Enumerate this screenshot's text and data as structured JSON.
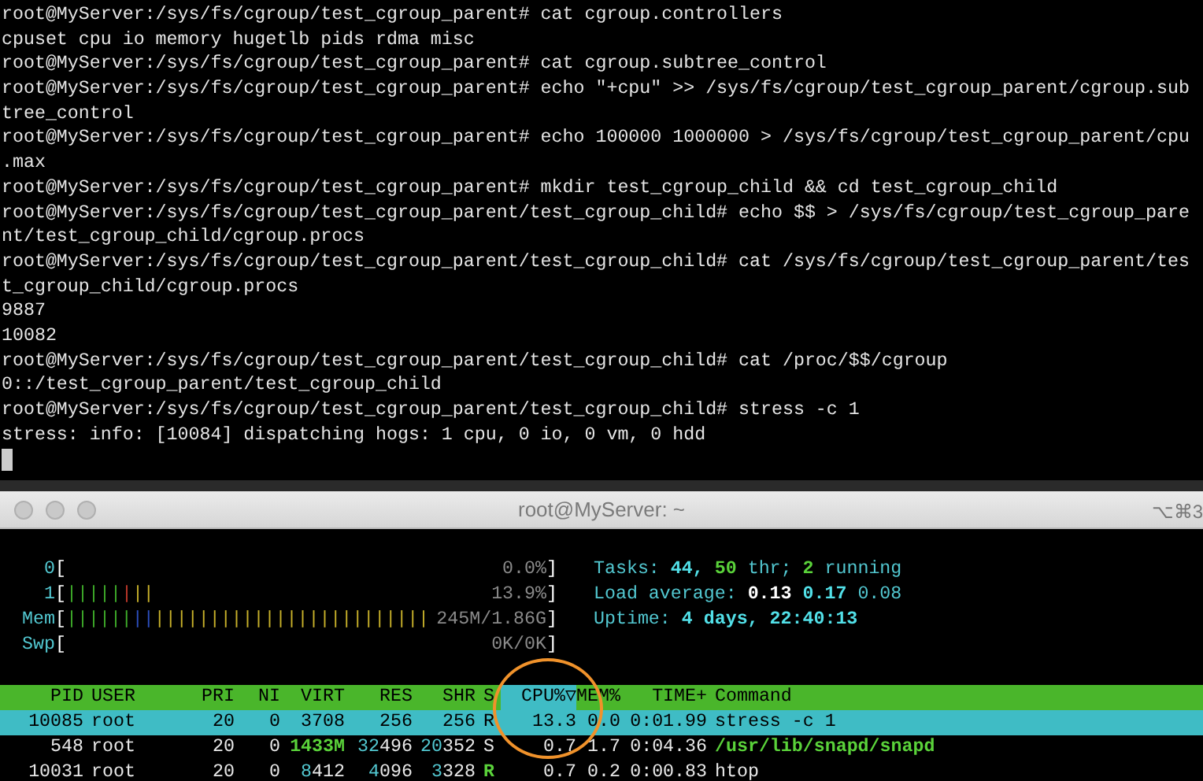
{
  "terminal": {
    "lines": [
      "root@MyServer:/sys/fs/cgroup/test_cgroup_parent# cat cgroup.controllers",
      "cpuset cpu io memory hugetlb pids rdma misc",
      "root@MyServer:/sys/fs/cgroup/test_cgroup_parent# cat cgroup.subtree_control",
      "root@MyServer:/sys/fs/cgroup/test_cgroup_parent# echo \"+cpu\" >> /sys/fs/cgroup/test_cgroup_parent/cgroup.sub",
      "tree_control",
      "root@MyServer:/sys/fs/cgroup/test_cgroup_parent# echo 100000 1000000 > /sys/fs/cgroup/test_cgroup_parent/cpu",
      ".max",
      "root@MyServer:/sys/fs/cgroup/test_cgroup_parent# mkdir test_cgroup_child && cd test_cgroup_child",
      "root@MyServer:/sys/fs/cgroup/test_cgroup_parent/test_cgroup_child# echo $$ > /sys/fs/cgroup/test_cgroup_pare",
      "nt/test_cgroup_child/cgroup.procs",
      "root@MyServer:/sys/fs/cgroup/test_cgroup_parent/test_cgroup_child# cat /sys/fs/cgroup/test_cgroup_parent/tes",
      "t_cgroup_child/cgroup.procs",
      "9887",
      "10082",
      "root@MyServer:/sys/fs/cgroup/test_cgroup_parent/test_cgroup_child# cat /proc/$$/cgroup",
      "0::/test_cgroup_parent/test_cgroup_child",
      "root@MyServer:/sys/fs/cgroup/test_cgroup_parent/test_cgroup_child# stress -c 1",
      "stress: info: [10084] dispatching hogs: 1 cpu, 0 io, 0 vm, 0 hdd"
    ]
  },
  "htop": {
    "title": "root@MyServer: ~",
    "shortcut": "⌥⌘3",
    "meters": [
      {
        "label": "0",
        "open": "[",
        "reading": "0.0%",
        "close": "]"
      },
      {
        "label": "1",
        "open": "[",
        "segments": [
          {
            "color": "#3fae2a",
            "text": "|||||"
          },
          {
            "color": "#c0392b",
            "text": "|"
          },
          {
            "color": "#c8b12a",
            "text": "||"
          }
        ],
        "reading": "13.9%",
        "close": "]"
      },
      {
        "label": "Mem",
        "open": "[",
        "segments": [
          {
            "color": "#3fae2a",
            "text": "||||||"
          },
          {
            "color": "#2c4fc0",
            "text": "||"
          },
          {
            "color": "#c8b12a",
            "text": "|||||||||||||||||||||||||"
          }
        ],
        "reading": "245M/1.86G",
        "close": "]"
      },
      {
        "label": "Swp",
        "open": "[",
        "reading": "0K/0K",
        "close": "]"
      }
    ],
    "info": [
      [
        {
          "text": "Tasks: ",
          "kind": "label"
        },
        {
          "text": "44, ",
          "kind": "bright"
        },
        {
          "text": "50 ",
          "kind": "green"
        },
        {
          "text": "thr; ",
          "kind": "label"
        },
        {
          "text": "2 ",
          "kind": "green"
        },
        {
          "text": "running",
          "kind": "label"
        }
      ],
      [
        {
          "text": "Load average: ",
          "kind": "label"
        },
        {
          "text": "0.13 ",
          "kind": "white"
        },
        {
          "text": "0.17 ",
          "kind": "bright"
        },
        {
          "text": "0.08",
          "kind": "label"
        }
      ],
      [
        {
          "text": "Uptime: ",
          "kind": "label"
        },
        {
          "text": "4 days, 22:40:13",
          "kind": "bright"
        }
      ]
    ],
    "columns": [
      {
        "label": "PID",
        "selected": false
      },
      {
        "label": "USER",
        "selected": false
      },
      {
        "label": "PRI",
        "selected": false
      },
      {
        "label": "NI",
        "selected": false
      },
      {
        "label": "VIRT",
        "selected": false
      },
      {
        "label": "RES",
        "selected": false
      },
      {
        "label": "SHR",
        "selected": false
      },
      {
        "label": "S",
        "selected": false
      },
      {
        "label": "CPU%▽",
        "selected": true
      },
      {
        "label": "MEM%",
        "selected": false
      },
      {
        "label": "TIME+",
        "selected": false
      },
      {
        "label": "Command",
        "selected": false
      }
    ],
    "rows": [
      {
        "selected": true,
        "cells": [
          [
            {
              "text": "10085",
              "kind": "plain"
            }
          ],
          [
            {
              "text": "root",
              "kind": "plain"
            }
          ],
          [
            {
              "text": "20",
              "kind": "plain"
            }
          ],
          [
            {
              "text": "0",
              "kind": "plain"
            }
          ],
          [
            {
              "text": "3708",
              "kind": "plain"
            }
          ],
          [
            {
              "text": "256",
              "kind": "plain"
            }
          ],
          [
            {
              "text": "256",
              "kind": "plain"
            }
          ],
          [
            {
              "text": "R",
              "kind": "plain"
            }
          ],
          [
            {
              "text": "13.3",
              "kind": "plain"
            }
          ],
          [
            {
              "text": "0.0",
              "kind": "plain"
            }
          ],
          [
            {
              "text": "0:01.99",
              "kind": "plain"
            }
          ],
          [
            {
              "text": "stress -c 1",
              "kind": "plain"
            }
          ]
        ]
      },
      {
        "selected": false,
        "cells": [
          [
            {
              "text": "548",
              "kind": "plain"
            }
          ],
          [
            {
              "text": "root",
              "kind": "plain"
            }
          ],
          [
            {
              "text": "20",
              "kind": "plain"
            }
          ],
          [
            {
              "text": "0",
              "kind": "plain"
            }
          ],
          [
            {
              "text": "1433M",
              "kind": "green"
            }
          ],
          [
            {
              "text": "32",
              "kind": "label"
            },
            {
              "text": "496",
              "kind": "plain"
            }
          ],
          [
            {
              "text": "20",
              "kind": "label"
            },
            {
              "text": "352",
              "kind": "plain"
            }
          ],
          [
            {
              "text": "S",
              "kind": "plain"
            }
          ],
          [
            {
              "text": "0.7",
              "kind": "plain"
            }
          ],
          [
            {
              "text": "1.7",
              "kind": "plain"
            }
          ],
          [
            {
              "text": "0:04.36",
              "kind": "plain"
            }
          ],
          [
            {
              "text": "/usr/lib/snapd/snapd",
              "kind": "green"
            }
          ]
        ]
      },
      {
        "selected": false,
        "cells": [
          [
            {
              "text": "10031",
              "kind": "plain"
            }
          ],
          [
            {
              "text": "root",
              "kind": "plain"
            }
          ],
          [
            {
              "text": "20",
              "kind": "plain"
            }
          ],
          [
            {
              "text": "0",
              "kind": "plain"
            }
          ],
          [
            {
              "text": "8",
              "kind": "label"
            },
            {
              "text": "412",
              "kind": "plain"
            }
          ],
          [
            {
              "text": "4",
              "kind": "label"
            },
            {
              "text": "096",
              "kind": "plain"
            }
          ],
          [
            {
              "text": "3",
              "kind": "label"
            },
            {
              "text": "328",
              "kind": "plain"
            }
          ],
          [
            {
              "text": "R",
              "kind": "green"
            }
          ],
          [
            {
              "text": "0.7",
              "kind": "plain"
            }
          ],
          [
            {
              "text": "0.2",
              "kind": "plain"
            }
          ],
          [
            {
              "text": "0:00.83",
              "kind": "plain"
            }
          ],
          [
            {
              "text": "htop",
              "kind": "plain"
            }
          ]
        ]
      }
    ]
  }
}
